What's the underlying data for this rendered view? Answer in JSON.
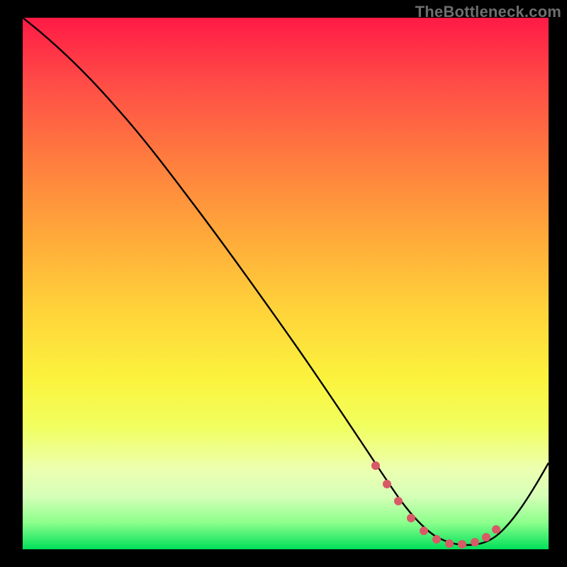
{
  "watermark": "TheBottleneck.com",
  "chart_data": {
    "type": "line",
    "title": "",
    "xlabel": "",
    "ylabel": "",
    "xlim": [
      0,
      100
    ],
    "ylim": [
      0,
      100
    ],
    "grid": false,
    "series": [
      {
        "name": "curve",
        "color": "#000000",
        "x": [
          0,
          5,
          10,
          15,
          20,
          25,
          30,
          35,
          40,
          45,
          50,
          55,
          60,
          63,
          66,
          70,
          74,
          78,
          82,
          85,
          88,
          92,
          96,
          100
        ],
        "y": [
          100,
          97,
          93,
          87,
          80,
          73,
          66,
          59,
          52,
          45,
          38,
          31,
          23,
          17,
          11,
          6,
          3,
          2,
          2,
          2,
          3,
          6,
          12,
          19
        ]
      }
    ],
    "highlight": {
      "name": "valley-dots",
      "color": "#d85a66",
      "x": [
        61,
        63,
        66,
        70,
        74,
        78,
        82,
        85,
        88
      ],
      "y": [
        22,
        17,
        11,
        6,
        3,
        2,
        2,
        2,
        3
      ]
    }
  }
}
